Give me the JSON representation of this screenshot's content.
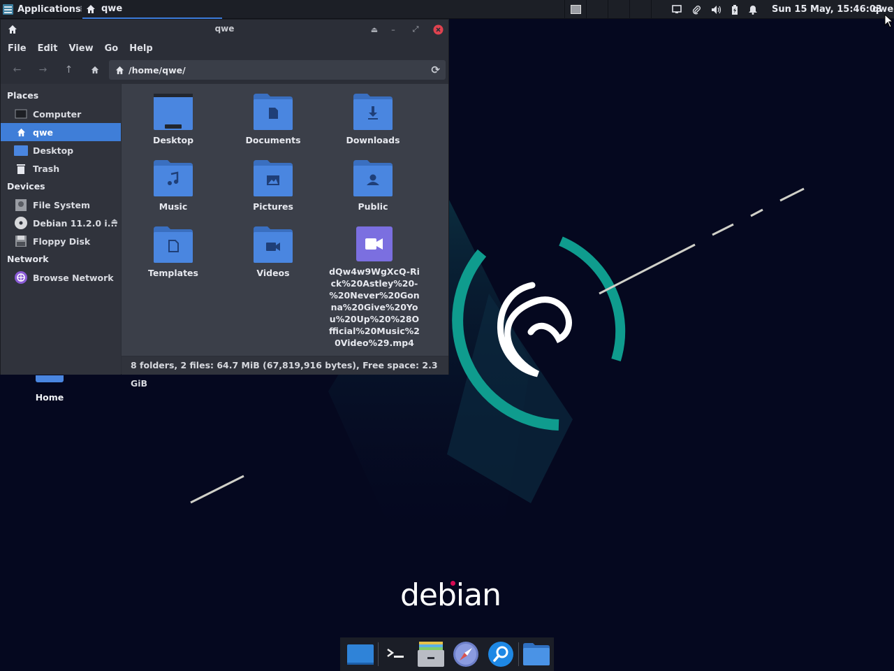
{
  "top_panel": {
    "applications_label": "Applications",
    "task_title": "qwe",
    "clock": "Sun 15 May, 15:46:03",
    "user": "qwe"
  },
  "window": {
    "title": "qwe",
    "menu": [
      "File",
      "Edit",
      "View",
      "Go",
      "Help"
    ],
    "location_path": "/home/qwe/"
  },
  "sidebar": {
    "places_header": "Places",
    "devices_header": "Devices",
    "network_header": "Network",
    "places": [
      {
        "label": "Computer",
        "icon": "computer-icon"
      },
      {
        "label": "qwe",
        "icon": "home-icon",
        "active": true
      },
      {
        "label": "Desktop",
        "icon": "desktop-icon"
      },
      {
        "label": "Trash",
        "icon": "trash-icon"
      }
    ],
    "devices": [
      {
        "label": "File System",
        "icon": "drive-icon"
      },
      {
        "label": "Debian 11.2.0 i...",
        "icon": "disc-icon"
      },
      {
        "label": "Floppy Disk",
        "icon": "floppy-icon"
      }
    ],
    "network": [
      {
        "label": "Browse Network",
        "icon": "network-icon"
      }
    ]
  },
  "files": [
    {
      "name": "Desktop",
      "icon": "folder-desktop-icon"
    },
    {
      "name": "Documents",
      "icon": "folder-documents-icon"
    },
    {
      "name": "Downloads",
      "icon": "folder-downloads-icon"
    },
    {
      "name": "Music",
      "icon": "folder-music-icon"
    },
    {
      "name": "Pictures",
      "icon": "folder-pictures-icon"
    },
    {
      "name": "Public",
      "icon": "folder-public-icon"
    },
    {
      "name": "Templates",
      "icon": "folder-templates-icon"
    },
    {
      "name": "Videos",
      "icon": "folder-videos-icon"
    },
    {
      "name": "dQw4w9WgXcQ-Rick%20Astley%20-%20Never%20Gonna%20Give%20You%20Up%20%28Official%20Music%20Video%29.mp4",
      "icon": "video-file-icon"
    }
  ],
  "status": "8 folders, 2 files: 64.7 MiB (67,819,916 bytes), Free space: 2.3 GiB",
  "desktop": {
    "home_label": "Home",
    "wallpaper_text": "debian"
  },
  "colors": {
    "accent": "#3f7ed8",
    "folder": "#4a86e0",
    "teal": "#0f9c8e",
    "debian_red": "#d70a53"
  }
}
